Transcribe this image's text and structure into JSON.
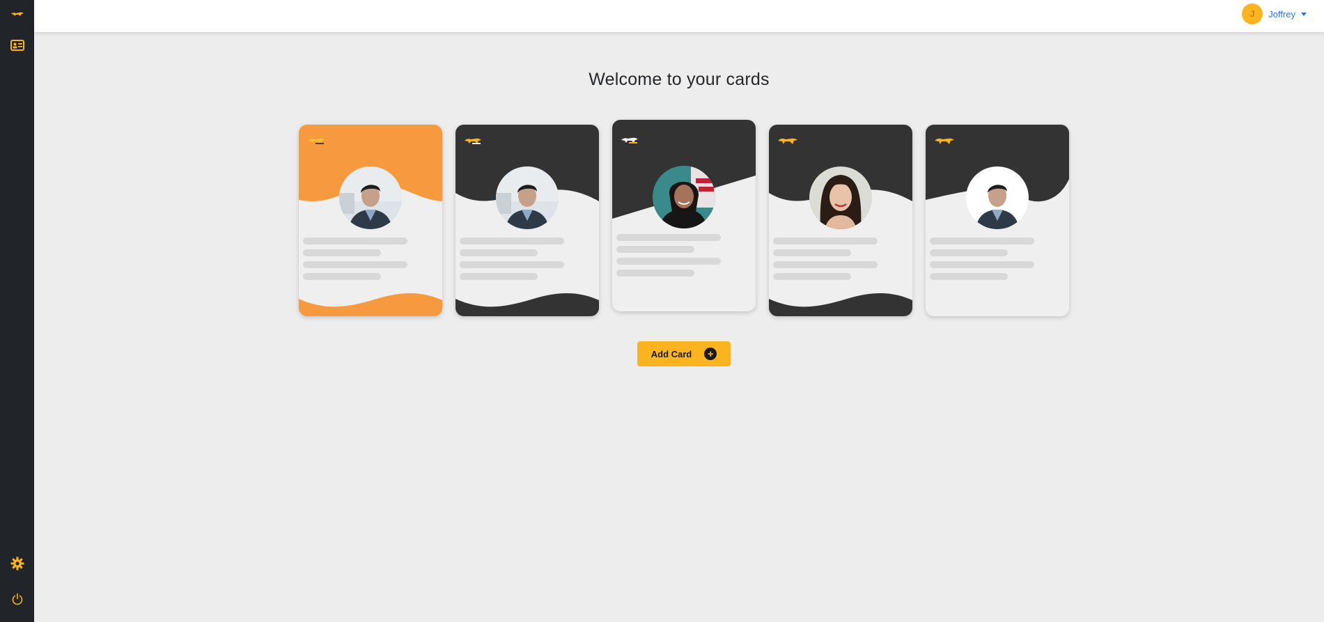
{
  "header": {
    "title": "Welcome to your cards"
  },
  "user": {
    "initial": "J",
    "name": "Joffrey"
  },
  "sidebar": {
    "icons": [
      "cheetah-logo-icon",
      "id-card-icon",
      "gear-icon",
      "power-icon"
    ]
  },
  "actions": {
    "add_card_label": "Add Card",
    "add_icon": "+"
  },
  "colors": {
    "accent": "#fbb41f",
    "orange": "#f7993f",
    "dark": "#333333",
    "sidebar": "#212529",
    "link": "#2a73d9"
  },
  "cards": [
    {
      "theme": "orange-wave",
      "photo": "man-photo"
    },
    {
      "theme": "dark-wave",
      "photo": "man-photo"
    },
    {
      "theme": "dark-diagonal",
      "photo": "woman-photo"
    },
    {
      "theme": "dark-wave",
      "photo": "woman-photo"
    },
    {
      "theme": "dark-top-wave",
      "photo": "man-photo"
    }
  ]
}
